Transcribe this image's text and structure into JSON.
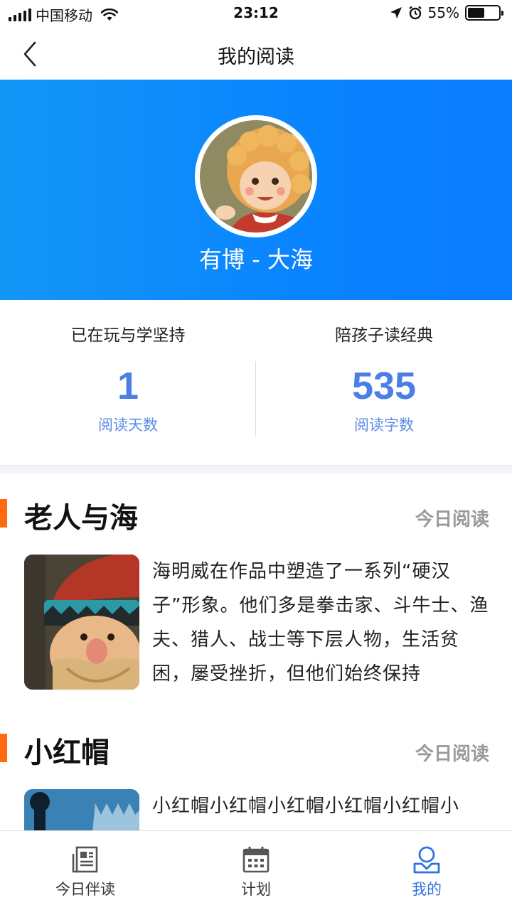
{
  "status_bar": {
    "carrier": "中国移动",
    "time": "23:12",
    "battery": "55%",
    "battery_level": 0.55
  },
  "nav": {
    "title": "我的阅读",
    "back_icon": "chevron-left-icon"
  },
  "profile": {
    "name": "有博 - 大海"
  },
  "stats": {
    "left": {
      "heading": "已在玩与学坚持",
      "value": "1",
      "caption": "阅读天数"
    },
    "right": {
      "heading": "陪孩子读经典",
      "value": "535",
      "caption": "阅读字数"
    }
  },
  "books": [
    {
      "title": "老人与海",
      "link": "今日阅读",
      "description": "海明威在作品中塑造了一系列“硬汉子”形象。他们多是拳击家、斗牛士、渔夫、猎人、战士等下层人物，生活贫困，屡受挫折，但他们始终保持"
    },
    {
      "title": "小红帽",
      "link": "今日阅读",
      "description": "小红帽小红帽小红帽小红帽小红帽小"
    }
  ],
  "tab_bar": {
    "tabs": [
      {
        "label": "今日伴读",
        "icon": "newspaper-icon"
      },
      {
        "label": "计划",
        "icon": "calendar-icon"
      },
      {
        "label": "我的",
        "icon": "profile-icon"
      }
    ],
    "active": "我的"
  },
  "colors": {
    "hero_blue": "#0a84ff",
    "stat_blue": "#4a7fe6",
    "accent_orange": "#ff6a10",
    "active_tab": "#2f73e0"
  }
}
